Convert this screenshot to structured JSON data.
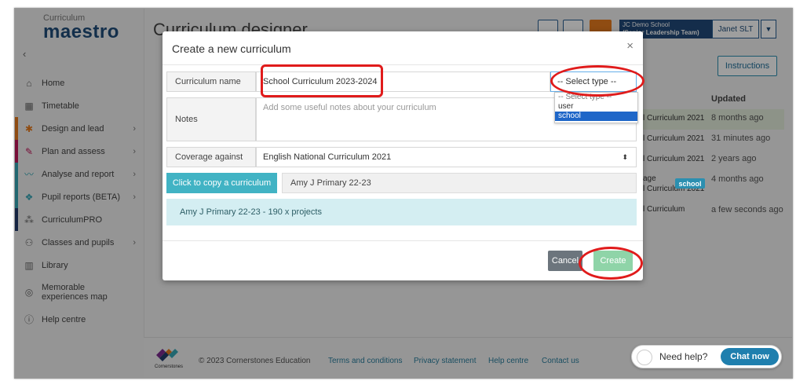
{
  "app": {
    "logo_small": "Curriculum",
    "logo_big": "maestro",
    "page_title": "Curriculum designer",
    "school_name": "JC Demo School",
    "school_role": "(Senior Leadership Team)",
    "user_name": "Janet SLT",
    "instructions_label": "Instructions"
  },
  "sidebar": {
    "items": [
      {
        "label": "Home",
        "icon": "home-icon"
      },
      {
        "label": "Timetable",
        "icon": "calendar-icon"
      },
      {
        "label": "Design and lead",
        "icon": "design-icon"
      },
      {
        "label": "Plan and assess",
        "icon": "pencil-icon"
      },
      {
        "label": "Analyse and report",
        "icon": "chart-icon"
      },
      {
        "label": "Pupil reports (BETA)",
        "icon": "report-icon"
      },
      {
        "label": "CurriculumPRO",
        "icon": "pro-icon"
      },
      {
        "label": "Classes and pupils",
        "icon": "people-icon"
      },
      {
        "label": "Library",
        "icon": "library-icon"
      },
      {
        "label": "Memorable experiences map",
        "icon": "compass-icon"
      },
      {
        "label": "Help centre",
        "icon": "info-icon"
      }
    ]
  },
  "table": {
    "updated_header": "Updated",
    "rows": [
      {
        "curriculum": "l Curriculum 2021",
        "updated": "8 months ago"
      },
      {
        "curriculum": "l Curriculum 2021",
        "updated": "31 minutes ago"
      },
      {
        "curriculum": "l Curriculum 2021",
        "updated": "2 years ago"
      },
      {
        "curriculum": "age",
        "curriculum_2": "l Curriculum 2021",
        "updated": "4 months ago"
      },
      {
        "curriculum": "l Curriculum",
        "updated": "a few seconds ago"
      }
    ]
  },
  "modal": {
    "title": "Create a new curriculum",
    "close": "×",
    "name_label": "Curriculum name",
    "name_value": "School Curriculum 2023-2024",
    "type_placeholder": "-- Select type --",
    "type_options": [
      "-- Select type --",
      "user",
      "school"
    ],
    "type_selected": "school",
    "notes_label": "Notes",
    "notes_placeholder": "Add some useful notes about your curriculum",
    "coverage_label": "Coverage against",
    "coverage_value": "English National Curriculum 2021",
    "copy_button": "Click to copy a curriculum",
    "copy_value": "Amy J Primary 22-23",
    "copy_badge": "school",
    "info_text": "Amy J Primary 22-23 - 190 x projects",
    "cancel_label": "Cancel",
    "create_label": "Create"
  },
  "footer": {
    "brand": "Cornerstones",
    "copyright": "© 2023 Cornerstones Education",
    "links": [
      "Terms and conditions",
      "Privacy statement",
      "Help centre",
      "Contact us"
    ],
    "need_help": "Need help?",
    "chat_now": "Chat now"
  }
}
